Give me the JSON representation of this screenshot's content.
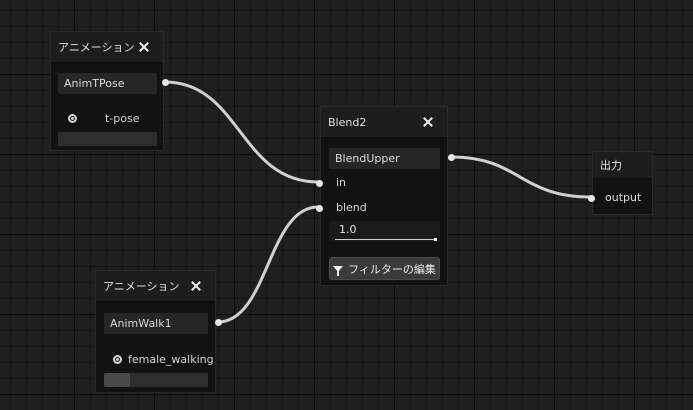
{
  "nodes": {
    "anim1": {
      "title": "アニメーション",
      "clip_name": "AnimTPose",
      "asset_name": "t-pose",
      "progress": 0
    },
    "anim2": {
      "title": "アニメーション",
      "clip_name": "AnimWalk1",
      "asset_name": "female_walking",
      "progress": 0.25
    },
    "blend": {
      "title": "Blend2",
      "output_name": "BlendUpper",
      "input_in_label": "in",
      "input_blend_label": "blend",
      "blend_value": "1.0",
      "blend_amount": 1.0,
      "filter_button_label": "フィルターの編集"
    },
    "output": {
      "title": "出力",
      "input_label": "output"
    }
  },
  "colors": {
    "wire": "#d0d0d0",
    "port": "#e6e6e6",
    "node_bg": "#121212",
    "header_bg": "#1d1d1d"
  }
}
